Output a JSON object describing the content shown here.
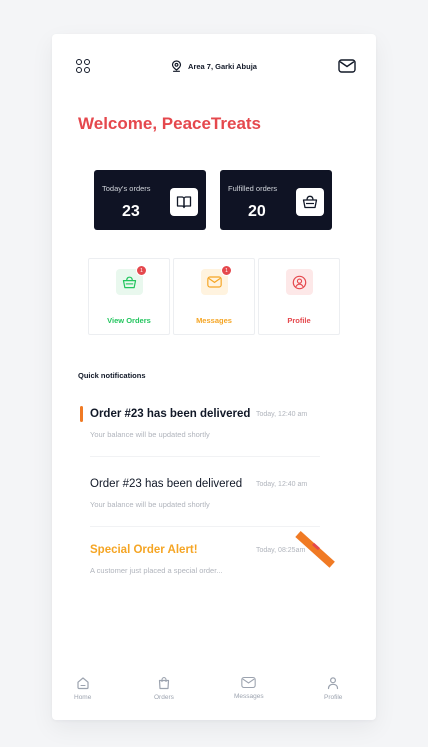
{
  "header": {
    "location": "Area 7, Garki Abuja"
  },
  "welcome": "Welcome, PeaceTreats",
  "stats": [
    {
      "label": "Today's orders",
      "value": "23"
    },
    {
      "label": "Fulfilled orders",
      "value": "20"
    }
  ],
  "tiles": [
    {
      "label": "View Orders",
      "badge": "1",
      "color": "#22c55e",
      "bg": "#e9f8ee"
    },
    {
      "label": "Messages",
      "badge": "1",
      "color": "#f5a524",
      "bg": "#fff3df"
    },
    {
      "label": "Profile",
      "color": "#e5484d",
      "bg": "#fde8e8"
    }
  ],
  "quick_notifications": {
    "title": "Quick notifications",
    "items": [
      {
        "title": "Order #23 has been delivered",
        "time": "Today, 12:40 am",
        "subtitle": "Your balance will be updated shortly"
      },
      {
        "title": "Order #23 has been delivered",
        "time": "Today, 12:40 am",
        "subtitle": "Your balance will be updated shortly"
      },
      {
        "title": "Special Order Alert!",
        "time": "Today, 08:25am",
        "subtitle": "A customer just placed a special order..."
      }
    ]
  },
  "nav": [
    {
      "label": "Home",
      "icon": "home-icon"
    },
    {
      "label": "Orders",
      "icon": "bag-icon"
    },
    {
      "label": "Messages",
      "icon": "mail-icon"
    },
    {
      "label": "Profile",
      "icon": "user-icon"
    }
  ],
  "colors": {
    "brand": "#e5484d",
    "dark": "#0f1324",
    "accent": "#f07a24",
    "warning": "#f5a524",
    "success": "#22c55e"
  }
}
